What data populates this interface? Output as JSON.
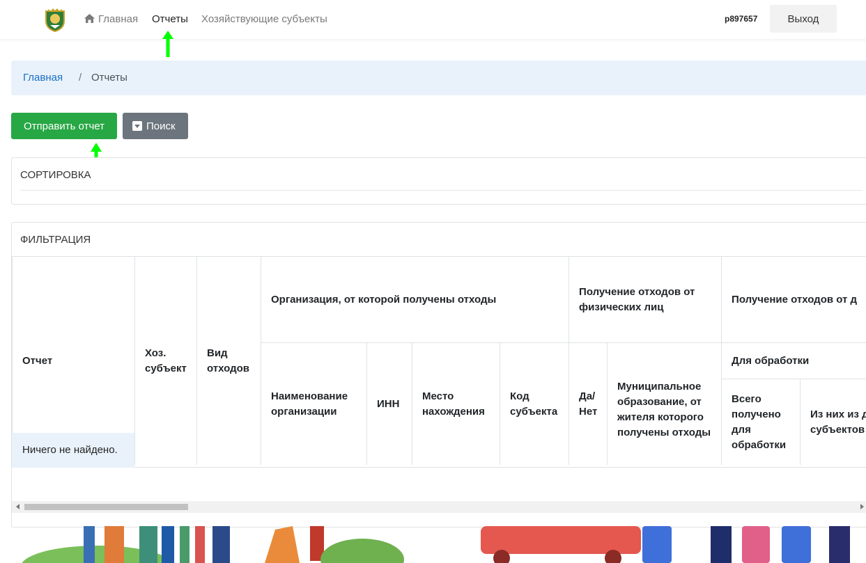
{
  "navbar": {
    "items": [
      {
        "label": "Главная",
        "icon": "home-icon"
      },
      {
        "label": "Отчеты"
      },
      {
        "label": "Хозяйствующие субъекты"
      }
    ],
    "user": "p897657",
    "logout_label": "Выход"
  },
  "breadcrumb": {
    "home": "Главная",
    "separator": "/",
    "current": "Отчеты"
  },
  "actions": {
    "send_label": "Отправить отчет",
    "search_label": "Поиск"
  },
  "sort_card": {
    "title": "СОРТИРОВКА"
  },
  "filter_card": {
    "title": "ФИЛЬТРАЦИЯ"
  },
  "table": {
    "headers": {
      "report": "Отчет",
      "entity": "Хоз. субъект",
      "waste_type": "Вид отходов",
      "org_group": "Организация, от которой получены отходы",
      "individuals_group": "Получение отходов от физических лиц",
      "other_group": "Получение отходов от д",
      "org_name": "Наименование организации",
      "inn": "ИНН",
      "location": "Место нахождения",
      "subject_code": "Код субъекта",
      "yes_no": "Да/ Нет",
      "municipality": "Муниципальное образование, от жителя которого получены отходы",
      "for_processing": "Для обработки",
      "total_received": "Всего получено для обработки",
      "from_other_subjects": "Из них из других субъектов РФ"
    },
    "empty_text": "Ничего не найдено."
  },
  "colors": {
    "accent_green": "#28a745",
    "secondary_gray": "#6c757d",
    "link_blue": "#1a6fc4",
    "breadcrumb_bg": "#e9f2fb",
    "annotation_arrow": "#00ff00"
  }
}
